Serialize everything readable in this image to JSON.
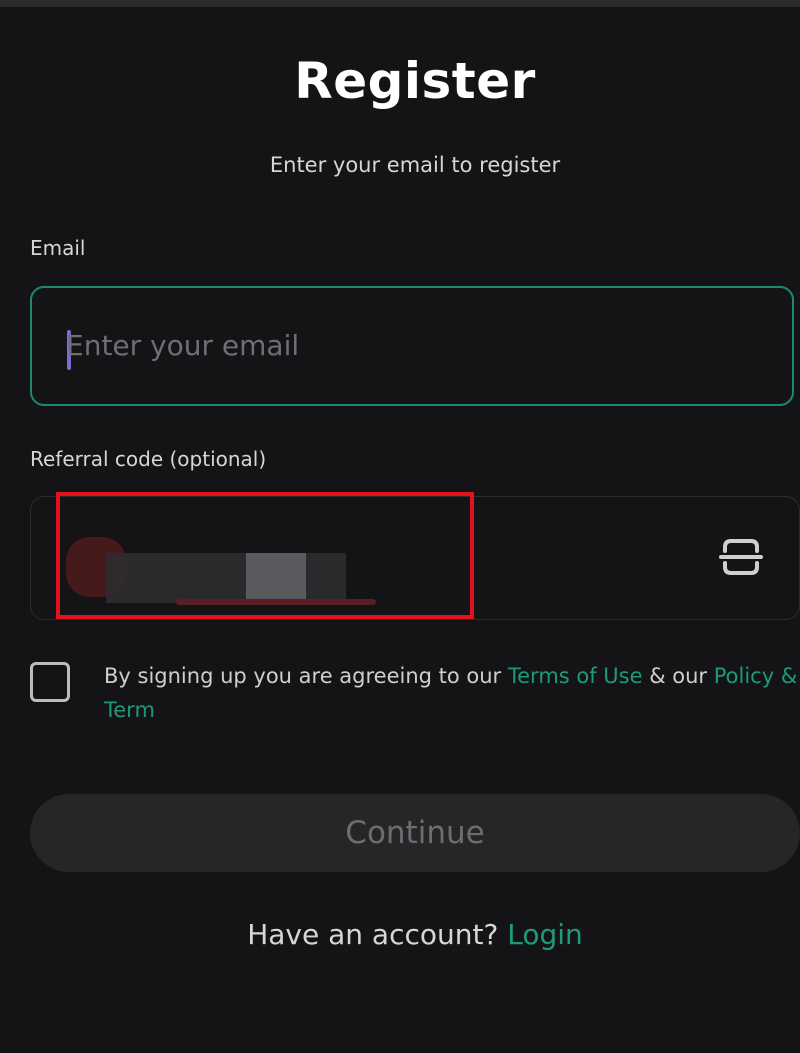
{
  "page": {
    "title": "Register",
    "subtitle": "Enter your email to register"
  },
  "email": {
    "label": "Email",
    "placeholder": "Enter your email"
  },
  "referral": {
    "label": "Referral code (optional)",
    "value_redacted": true,
    "scan_icon": "scan-icon"
  },
  "terms": {
    "prefix": "By signing up you are agreeing to our ",
    "terms_link": "Terms of Use",
    "middle": " & our ",
    "policy_link": "Policy & Term",
    "checked": false
  },
  "actions": {
    "continue_label": "Continue"
  },
  "footer": {
    "prompt": "Have an account?",
    "login_link": "Login"
  },
  "colors": {
    "background": "#141416",
    "accent": "#1f9a77",
    "field_border_active": "#1f8a6b",
    "highlight": "#e0141a",
    "button_bg": "#262628"
  }
}
